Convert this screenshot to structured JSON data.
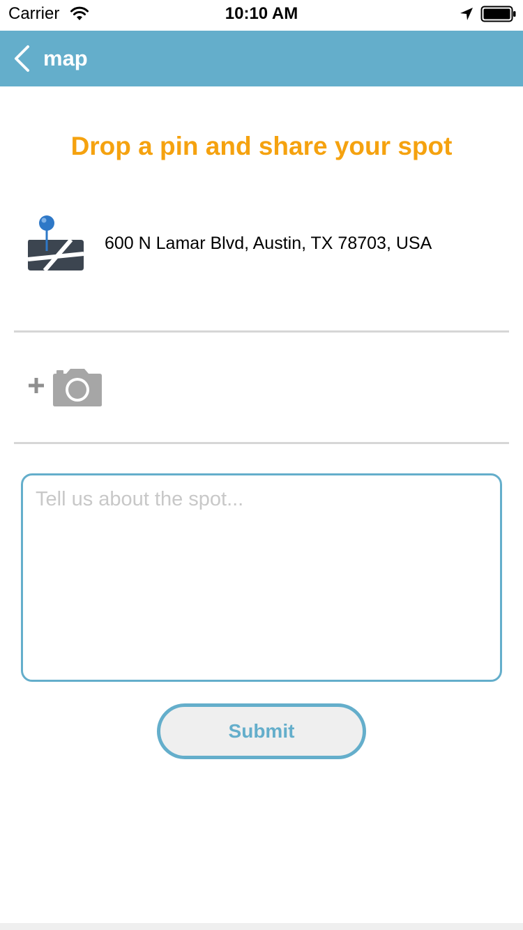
{
  "status_bar": {
    "carrier": "Carrier",
    "time": "10:10 AM",
    "icons": [
      "wifi-icon",
      "location-arrow-icon",
      "battery-icon"
    ]
  },
  "nav": {
    "back_label": "map",
    "back_icon": "chevron-left-icon",
    "background_color": "#64aecb"
  },
  "heading": {
    "text": "Drop a pin and share your spot",
    "color": "#f5a20f"
  },
  "location": {
    "icon": "map-pin-icon",
    "address": "600 N Lamar Blvd, Austin, TX 78703, USA"
  },
  "photo": {
    "icons": [
      "plus-icon",
      "camera-icon"
    ]
  },
  "description": {
    "placeholder": "Tell us about the spot...",
    "value": ""
  },
  "submit": {
    "label": "Submit",
    "accent_color": "#64aecb"
  }
}
